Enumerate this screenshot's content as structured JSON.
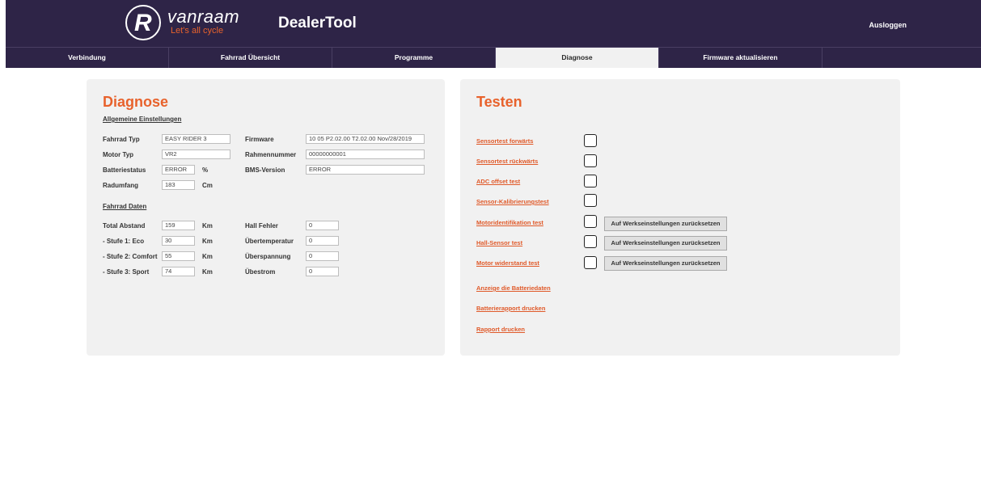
{
  "header": {
    "logo_letter": "R",
    "logo_name": "vanraam",
    "logo_tagline": "Let's all cycle",
    "app_title": "DealerTool",
    "logout_label": "Ausloggen"
  },
  "tabs": [
    {
      "label": "Verbindung",
      "active": false
    },
    {
      "label": "Fahrrad Übersicht",
      "active": false
    },
    {
      "label": "Programme",
      "active": false
    },
    {
      "label": "Diagnose",
      "active": true
    },
    {
      "label": "Firmware aktualisieren",
      "active": false
    }
  ],
  "diagnose": {
    "title": "Diagnose",
    "general_section": "Allgemeine Einstellungen",
    "fahrrad_typ": {
      "label": "Fahrrad Typ",
      "value": "EASY RIDER 3"
    },
    "motor_typ": {
      "label": "Motor Typ",
      "value": "VR2"
    },
    "batteriestatus": {
      "label": "Batteriestatus",
      "value": "ERROR",
      "unit": "%"
    },
    "radumfang": {
      "label": "Radumfang",
      "value": "183",
      "unit": "Cm"
    },
    "firmware": {
      "label": "Firmware",
      "value": "10 05 P2.02.00 T2.02.00 Nov/28/2019"
    },
    "rahmennummer": {
      "label": "Rahmennummer",
      "value": "00000000001"
    },
    "bms_version": {
      "label": "BMS-Version",
      "value": "ERROR"
    },
    "bike_data_section": "Fahrrad Daten",
    "total_abstand": {
      "label": "Total Abstand",
      "value": "159",
      "unit": "Km"
    },
    "stufe1": {
      "label": "- Stufe 1: Eco",
      "value": "30",
      "unit": "Km"
    },
    "stufe2": {
      "label": "- Stufe 2: Comfort",
      "value": "55",
      "unit": "Km"
    },
    "stufe3": {
      "label": "- Stufe 3: Sport",
      "value": "74",
      "unit": "Km"
    },
    "hall_fehler": {
      "label": "Hall Fehler",
      "value": "0"
    },
    "uebertemperatur": {
      "label": "Übertemperatur",
      "value": "0"
    },
    "ueberspannung": {
      "label": "Überspannung",
      "value": "0"
    },
    "uebestrom": {
      "label": "Übestrom",
      "value": "0"
    }
  },
  "testen": {
    "title": "Testen",
    "tests": [
      {
        "label": "Sensortest forwärts"
      },
      {
        "label": "Sensortest rückwärts"
      },
      {
        "label": "ADC offset test"
      },
      {
        "label": "Sensor-Kalibrierungstest"
      },
      {
        "label": "Motoridentifikation test",
        "button": "Auf Werkseinstellungen zurücksetzen"
      },
      {
        "label": "Hall-Sensor test",
        "button": "Auf Werkseinstellungen zurücksetzen"
      },
      {
        "label": "Motor widerstand test",
        "button": "Auf Werkseinstellungen zurücksetzen"
      }
    ],
    "links": [
      {
        "label": "Anzeige die Batteriedaten"
      },
      {
        "label": "Batterierapport drucken"
      },
      {
        "label": "Rapport drucken"
      }
    ]
  },
  "colors": {
    "header_bg": "#2e2447",
    "accent": "#e8622c",
    "panel_bg": "#f1f1f1"
  }
}
